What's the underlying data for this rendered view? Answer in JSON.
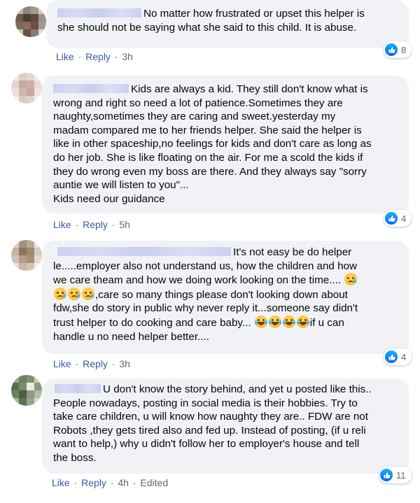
{
  "comments": [
    {
      "text_lines": [
        "No matter how frustrated or upset this helper is",
        "she should not be saying what she said to this child. It is abuse."
      ],
      "like_label": "Like",
      "reply_label": "Reply",
      "time": "3h",
      "reaction_count": "8",
      "edited": ""
    },
    {
      "text_lines": [
        "Kids are always a kid. They still don't know what is",
        "wrong and right so need a lot of patience.Sometimes they are",
        "naughty,sometimes they are caring and sweet.yesterday my",
        "madam compared me to her friends helper. She said the helper is",
        "like in other spaceship,no feelings for kids and don't care as long as",
        "do her job. She is like floating on the air. For me a scold the kids if",
        "they do wrong even my boss are there. And they always say \"sorry",
        "auntie we will listen to you\"...",
        "Kids need our guidance"
      ],
      "like_label": "Like",
      "reply_label": "Reply",
      "time": "5h",
      "reaction_count": "4",
      "edited": ""
    },
    {
      "text_parts": {
        "line1": "It's not easy be do helper",
        "line2": "le.....employer also not understand us, how the children and how",
        "line3": "we care theam and how we doing work looking on the time....",
        "line4": ",care so many things please don't looking down about",
        "line5": "fdw,she do story in public why never reply it...someone say didn't",
        "line6a": "trust helper to do cooking and care baby...",
        "line6b": "if u can",
        "line7": "handle u no need helper better...."
      },
      "like_label": "Like",
      "reply_label": "Reply",
      "time": "3h",
      "reaction_count": "4",
      "edited": ""
    },
    {
      "text_lines": [
        "U don't know the story behind, and yet u posted like this..",
        "People nowadays, posting in social media is their hobbies. Try to",
        "take care children, u will know how naughty they are.. FDW are not",
        "Robots ,they gets tired also and fed up. Instead of posting, (if u reli",
        "want to help,) why u didn't follow her to employer's house and tell",
        "the boss."
      ],
      "like_label": "Like",
      "reply_label": "Reply",
      "time": "4h",
      "reaction_count": "11",
      "edited": "Edited"
    }
  ],
  "icons": {
    "reaction": "like-thumb-icon",
    "emoji_sad": "disappointed-relieved-emoji",
    "emoji_laugh": "tears-of-joy-emoji"
  },
  "colors": {
    "bubble": "#f0f2f5",
    "link": "#3b5998",
    "meta": "#65676b",
    "like_blue": "#0866ff"
  }
}
